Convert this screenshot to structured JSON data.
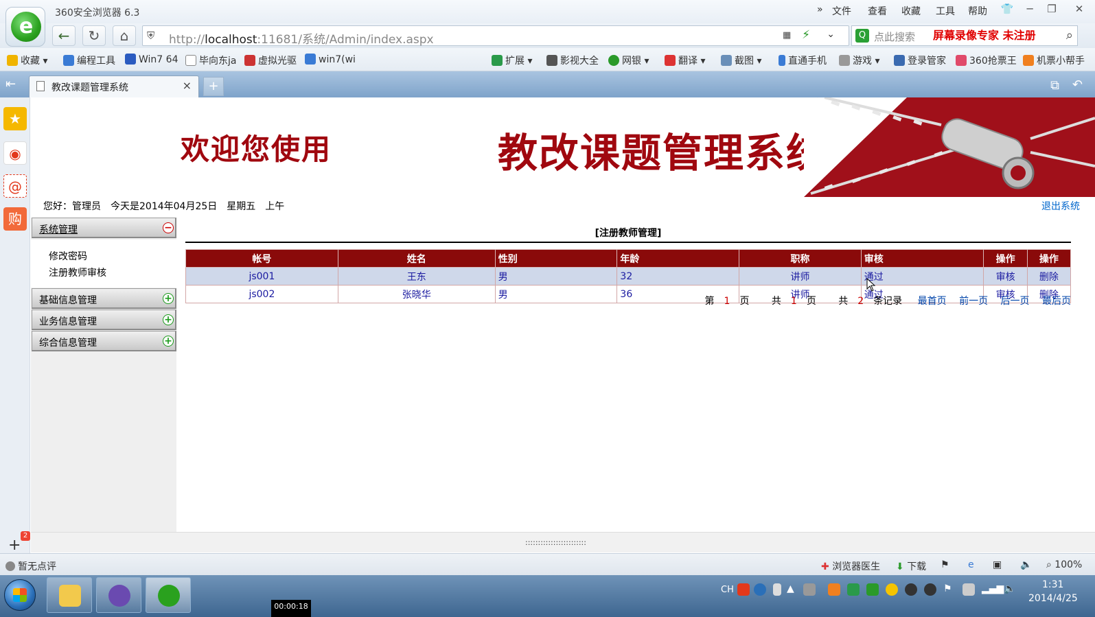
{
  "browser": {
    "app_title": "360安全浏览器 6.3",
    "menus": [
      "文件",
      "查看",
      "收藏",
      "工具",
      "帮助"
    ],
    "more_menus": "»",
    "window_buttons": [
      "─",
      "❐",
      "✕"
    ],
    "url_prefix": "http://",
    "url_host": "localhost",
    "url_rest": ":11681/系统/Admin/index.aspx",
    "search_placeholder": "点此搜索",
    "recorder_text": "屏幕录像专家 未注册",
    "bookmarks": [
      "收藏",
      "编程工具",
      "Win7 64",
      "毕向东ja",
      "虚拟光驱",
      "win7(wi",
      "扩展",
      "影视大全",
      "网银",
      "翻译",
      "截图",
      "直通手机",
      "游戏",
      "登录管家",
      "360抢票王",
      "机票小帮手"
    ],
    "tab_title": "教改课题管理系统",
    "tab_close": "×",
    "new_tab": "+",
    "rail_badge": "2",
    "scroll_grip": "::::::::::::::::::::::::",
    "status": {
      "rating": "暂无点评",
      "doctor": "浏览器医生",
      "download": "下载",
      "zoom": "100%"
    }
  },
  "page": {
    "welcome": "欢迎您使用",
    "system_title": "教改课题管理系统",
    "greeting": {
      "hello": "您好：管理员",
      "date": "今天是2014年04月25日",
      "weekday": "星期五",
      "period": "上午"
    },
    "logout": "退出系统",
    "menu": {
      "system": "系统管理",
      "system_items": [
        "修改密码",
        "注册教师审核"
      ],
      "basic": "基础信息管理",
      "business": "业务信息管理",
      "overall": "综合信息管理"
    },
    "table_title": "[注册教师管理]",
    "columns": [
      "帐号",
      "姓名",
      "性别",
      "年龄",
      "职称",
      "审核",
      "操作",
      "操作"
    ],
    "rows": [
      {
        "account": "js001",
        "name": "王东",
        "gender": "男",
        "age": "32",
        "title": "讲师",
        "status": "通过",
        "op1": "审核",
        "op2": "删除"
      },
      {
        "account": "js002",
        "name": "张晓华",
        "gender": "男",
        "age": "36",
        "title": "讲师",
        "status": "通过",
        "op1": "审核",
        "op2": "删除"
      }
    ],
    "pager": {
      "page_prefix": "第",
      "page_num": "1",
      "page_suffix": "页",
      "total_prefix": "共",
      "total_num": "1",
      "total_suffix": "页",
      "records_prefix": "共",
      "records_num": "2",
      "records_suffix": "条记录",
      "first": "最首页",
      "prev": "前一页",
      "next": "后一页",
      "last": "最后页"
    }
  },
  "taskbar": {
    "lang": "CH",
    "time": "1:31",
    "date": "2014/4/25",
    "recording_time": "00:00:18"
  }
}
